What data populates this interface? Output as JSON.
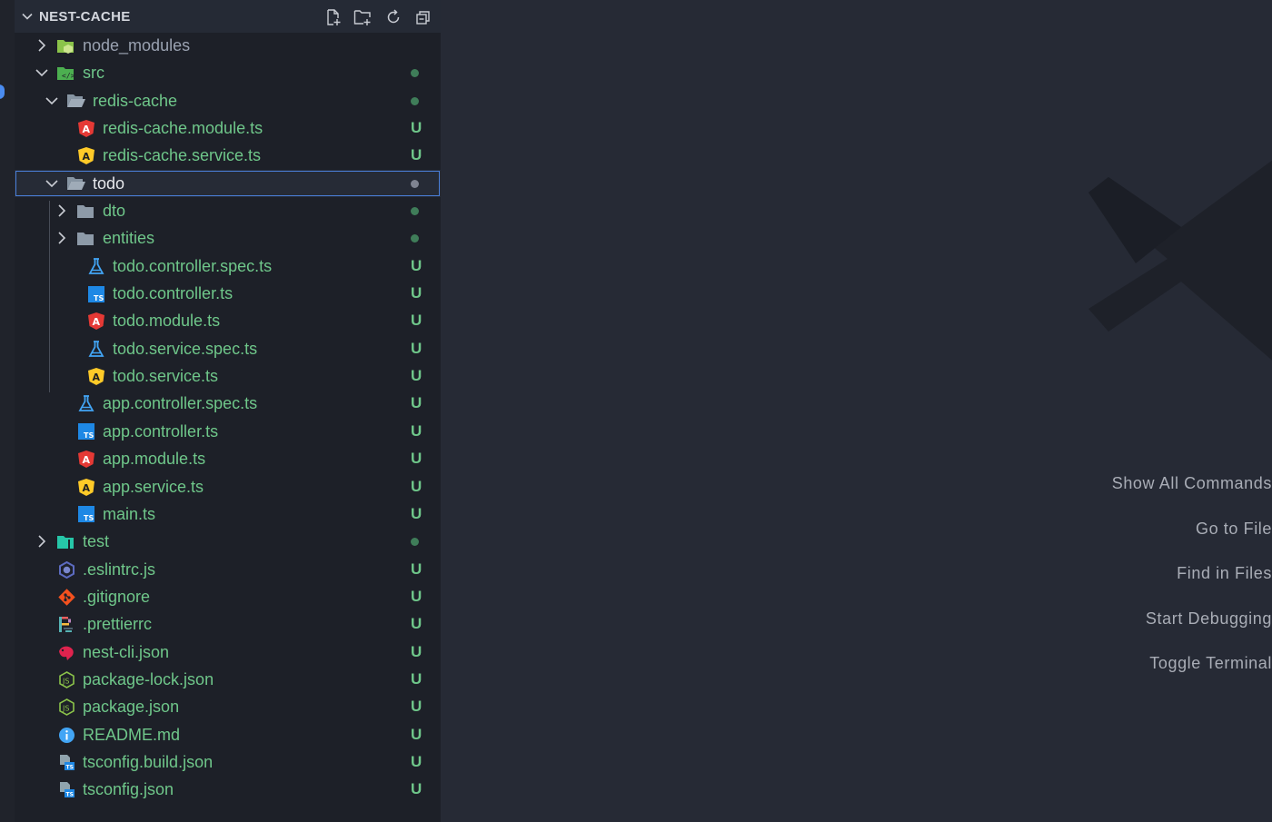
{
  "explorer": {
    "title": "NEST-CACHE",
    "actions": [
      "new-file-icon",
      "new-folder-icon",
      "refresh-icon",
      "collapse-all-icon"
    ]
  },
  "tree": [
    {
      "label": "node_modules",
      "type": "folder",
      "expanded": false,
      "icon": "node-modules-folder-icon",
      "status": "",
      "dim": true
    },
    {
      "label": "src",
      "type": "folder",
      "expanded": true,
      "icon": "src-folder-icon",
      "status": "dot"
    },
    {
      "label": "redis-cache",
      "type": "folder",
      "expanded": true,
      "icon": "folder-open-icon",
      "status": "dot"
    },
    {
      "label": "redis-cache.module.ts",
      "type": "file",
      "icon": "angular-module-icon",
      "status": "U"
    },
    {
      "label": "redis-cache.service.ts",
      "type": "file",
      "icon": "angular-service-icon",
      "status": "U"
    },
    {
      "label": "todo",
      "type": "folder",
      "expanded": true,
      "icon": "folder-open-icon",
      "status": "dot",
      "selected": true
    },
    {
      "label": "dto",
      "type": "folder",
      "expanded": false,
      "icon": "folder-icon",
      "status": "dot"
    },
    {
      "label": "entities",
      "type": "folder",
      "expanded": false,
      "icon": "folder-icon",
      "status": "dot"
    },
    {
      "label": "todo.controller.spec.ts",
      "type": "file",
      "icon": "test-flask-icon",
      "status": "U"
    },
    {
      "label": "todo.controller.ts",
      "type": "file",
      "icon": "typescript-icon",
      "status": "U"
    },
    {
      "label": "todo.module.ts",
      "type": "file",
      "icon": "angular-module-icon",
      "status": "U"
    },
    {
      "label": "todo.service.spec.ts",
      "type": "file",
      "icon": "test-flask-icon",
      "status": "U"
    },
    {
      "label": "todo.service.ts",
      "type": "file",
      "icon": "angular-service-icon",
      "status": "U"
    },
    {
      "label": "app.controller.spec.ts",
      "type": "file",
      "icon": "test-flask-icon",
      "status": "U"
    },
    {
      "label": "app.controller.ts",
      "type": "file",
      "icon": "typescript-icon",
      "status": "U"
    },
    {
      "label": "app.module.ts",
      "type": "file",
      "icon": "angular-module-icon",
      "status": "U"
    },
    {
      "label": "app.service.ts",
      "type": "file",
      "icon": "angular-service-icon",
      "status": "U"
    },
    {
      "label": "main.ts",
      "type": "file",
      "icon": "typescript-icon",
      "status": "U"
    },
    {
      "label": "test",
      "type": "folder",
      "expanded": false,
      "icon": "test-folder-icon",
      "status": "dot"
    },
    {
      "label": ".eslintrc.js",
      "type": "file",
      "icon": "eslint-icon",
      "status": "U"
    },
    {
      "label": ".gitignore",
      "type": "file",
      "icon": "git-icon",
      "status": "U"
    },
    {
      "label": ".prettierrc",
      "type": "file",
      "icon": "prettier-icon",
      "status": "U"
    },
    {
      "label": "nest-cli.json",
      "type": "file",
      "icon": "nestjs-icon",
      "status": "U"
    },
    {
      "label": "package-lock.json",
      "type": "file",
      "icon": "nodejs-icon",
      "status": "U"
    },
    {
      "label": "package.json",
      "type": "file",
      "icon": "nodejs-icon",
      "status": "U"
    },
    {
      "label": "README.md",
      "type": "file",
      "icon": "info-icon",
      "status": "U"
    },
    {
      "label": "tsconfig.build.json",
      "type": "file",
      "icon": "tsconfig-icon",
      "status": "U"
    },
    {
      "label": "tsconfig.json",
      "type": "file",
      "icon": "tsconfig-icon",
      "status": "U"
    }
  ],
  "editor": {
    "watermark_icon": "vscode-logo-icon",
    "commands": [
      "Show All Commands",
      "Go to File",
      "Find in Files",
      "Start Debugging",
      "Toggle Terminal"
    ]
  },
  "colors": {
    "untracked": "#6fc78a",
    "selection_border": "#4a7fd9",
    "sidebar_bg": "#1d2028",
    "editor_bg": "#262a35"
  }
}
